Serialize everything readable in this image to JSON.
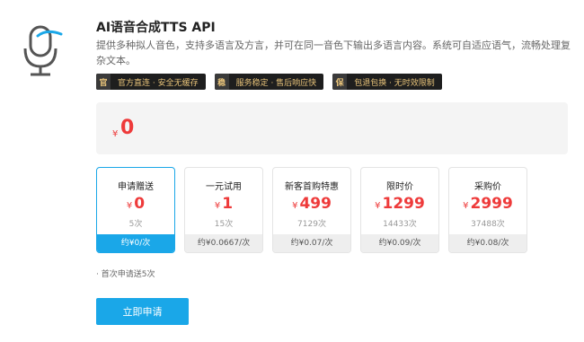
{
  "product": {
    "title": "AI语音合成TTS API",
    "description": "提供多种拟人音色，支持多语言及方言，并可在同一音色下输出多语言内容。系统可自适应语气，流畅处理复杂文本。"
  },
  "tags": [
    {
      "badge": "官",
      "label": "官方直连 · 安全无缓存"
    },
    {
      "badge": "稳",
      "label": "服务稳定 · 售后响应快"
    },
    {
      "badge": "保",
      "label": "包退包换 · 无时效限制"
    }
  ],
  "price_panel": {
    "currency": "¥",
    "amount": "0"
  },
  "plans": [
    {
      "name": "申请赠送",
      "currency": "¥",
      "price": "0",
      "count": "5次",
      "unit_price": "约¥0/次",
      "selected": true
    },
    {
      "name": "一元试用",
      "currency": "¥",
      "price": "1",
      "count": "15次",
      "unit_price": "约¥0.0667/次",
      "selected": false
    },
    {
      "name": "新客首购特惠",
      "currency": "¥",
      "price": "499",
      "count": "7129次",
      "unit_price": "约¥0.07/次",
      "selected": false
    },
    {
      "name": "限时价",
      "currency": "¥",
      "price": "1299",
      "count": "14433次",
      "unit_price": "约¥0.09/次",
      "selected": false
    },
    {
      "name": "采购价",
      "currency": "¥",
      "price": "2999",
      "count": "37488次",
      "unit_price": "约¥0.08/次",
      "selected": false
    }
  ],
  "note": "· 首次申请送5次",
  "apply_button": "立即申请",
  "colors": {
    "accent": "#1aa7e8",
    "price": "#ee3a3a",
    "tag_bg": "#1e1e1e",
    "tag_text": "#e9c47a"
  }
}
